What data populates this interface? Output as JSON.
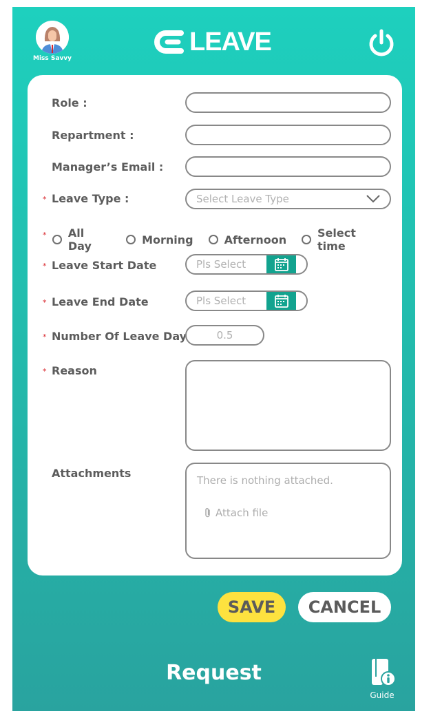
{
  "header": {
    "user_name": "Miss Savvy",
    "app_title": "LEAVE",
    "logout_icon": "power-icon"
  },
  "form": {
    "role": {
      "label": "Role :",
      "value": "",
      "required": false
    },
    "department": {
      "label": "Repartment :",
      "value": "",
      "required": false
    },
    "manager_email": {
      "label": "Manager’s Email :",
      "value": "",
      "required": false
    },
    "leave_type": {
      "label": "Leave Type :",
      "placeholder": "Select Leave Type",
      "required": true
    },
    "time_options": {
      "required": true,
      "options": [
        "All Day",
        "Morning",
        "Afternoon",
        "Select time"
      ],
      "selected": null
    },
    "leave_start_date": {
      "label": "Leave Start Date",
      "placeholder": "Pls Select",
      "required": true
    },
    "leave_end_date": {
      "label": "Leave End Date",
      "placeholder": "Pls Select",
      "required": true
    },
    "number_of_days": {
      "label": "Number Of Leave Days",
      "value": "0.5",
      "required": true
    },
    "reason": {
      "label": "Reason",
      "value": "",
      "required": true
    },
    "attachments": {
      "label": "Attachments",
      "empty_text": "There is nothing attached.",
      "attach_label": "Attach file"
    },
    "required_marker": "*"
  },
  "actions": {
    "save_label": "SAVE",
    "cancel_label": "CANCEL"
  },
  "footer": {
    "title": "Request",
    "guide_label": "Guide"
  },
  "colors": {
    "bg_top": "#1ed0be",
    "bg_bottom": "#29a39f",
    "calendar_button": "#12a38f",
    "save_button": "#fde23f",
    "required": "#d9262c"
  }
}
